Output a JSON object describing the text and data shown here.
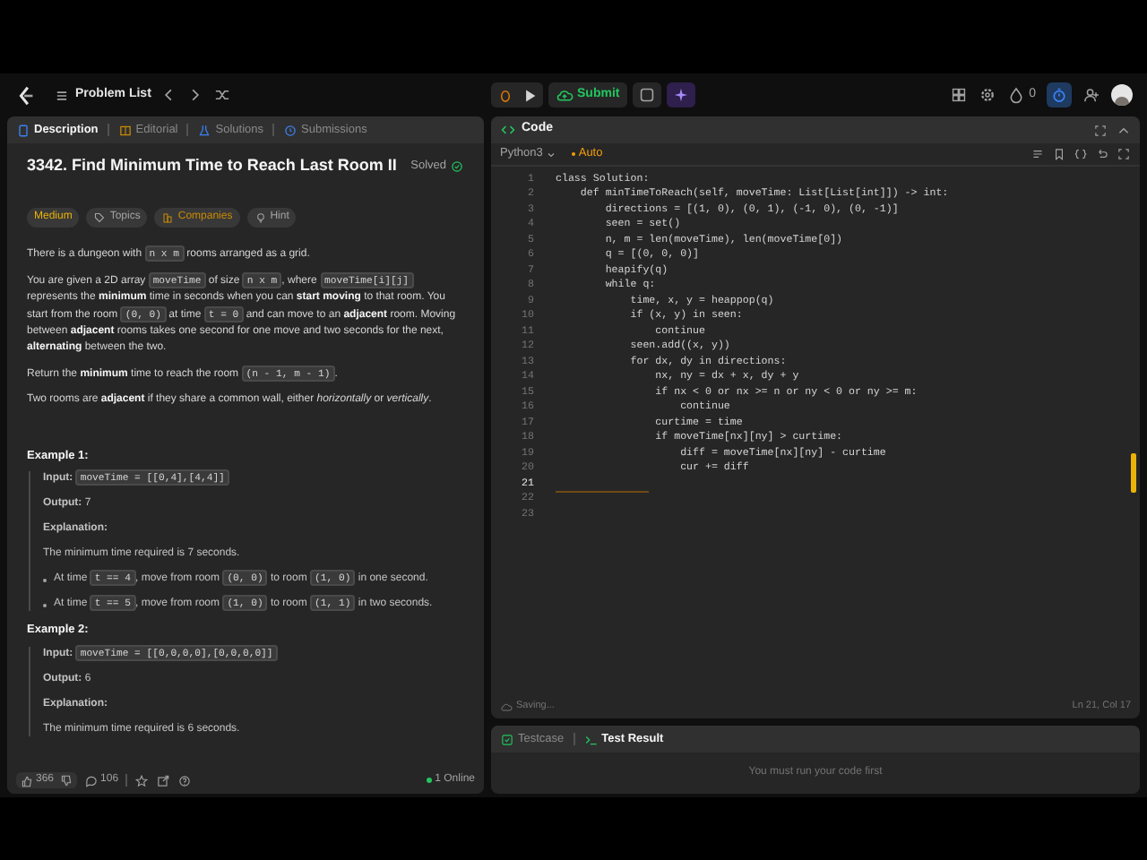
{
  "nav": {
    "problem_list": "Problem List",
    "submit": "Submit",
    "streak": "0"
  },
  "left_tabs": [
    {
      "label": "Description",
      "selected": true
    },
    {
      "label": "Editorial",
      "selected": false
    },
    {
      "label": "Solutions",
      "selected": false
    },
    {
      "label": "Submissions",
      "selected": false
    }
  ],
  "problem": {
    "title": "3342. Find Minimum Time to Reach Last Room II",
    "status": "Solved",
    "tags": [
      {
        "label": "Medium",
        "kind": "difficulty"
      },
      {
        "label": "Topics",
        "kind": "topics"
      },
      {
        "label": "Companies",
        "kind": "companies"
      },
      {
        "label": "Hint",
        "kind": "hint"
      }
    ],
    "paragraphs": [
      [
        {
          "kind": "text",
          "text": "There is a dungeon with "
        },
        {
          "kind": "code",
          "text": "n x m"
        },
        {
          "kind": "text",
          "text": " rooms arranged as a grid."
        }
      ],
      [
        {
          "kind": "text",
          "text": "You are given a 2D array "
        },
        {
          "kind": "code",
          "text": "moveTime"
        },
        {
          "kind": "text",
          "text": " of size "
        },
        {
          "kind": "code",
          "text": "n x m"
        },
        {
          "kind": "text",
          "text": ", where "
        },
        {
          "kind": "code",
          "text": "moveTime[i][j]"
        },
        {
          "kind": "text",
          "text": " represents the **minimum** time in seconds when you can **start moving** to that room. You start from the room "
        },
        {
          "kind": "code",
          "text": "(0, 0)"
        },
        {
          "kind": "text",
          "text": " at time "
        },
        {
          "kind": "code",
          "text": "t = 0"
        },
        {
          "kind": "text",
          "text": " and can move to an **adjacent** room. Moving between **adjacent** rooms takes one second for one move and two seconds for the next, **alternating** between the two."
        }
      ],
      [
        {
          "kind": "text",
          "text": "Return the **minimum** time to reach the room "
        },
        {
          "kind": "code",
          "text": "(n - 1, m - 1)"
        },
        {
          "kind": "text",
          "text": "."
        }
      ],
      [
        {
          "kind": "text",
          "text": "Two rooms are **adjacent** if they share a common wall, either *horizontally* or *vertically*."
        }
      ]
    ],
    "examples": [
      {
        "title": "Example 1:",
        "lines": [
          {
            "kind": "line",
            "segments": [
              {
                "kind": "text",
                "text": "**Input:** "
              },
              {
                "kind": "code",
                "text": "moveTime = [[0,4],[4,4]]"
              }
            ]
          },
          {
            "kind": "line",
            "segments": [
              {
                "kind": "text",
                "text": "**Output:** 7"
              }
            ]
          },
          {
            "kind": "line",
            "segments": [
              {
                "kind": "text",
                "text": "**Explanation:**"
              }
            ]
          },
          {
            "kind": "line",
            "segments": [
              {
                "kind": "text",
                "text": "The minimum time required is 7 seconds."
              }
            ]
          },
          {
            "kind": "bullet",
            "segments": [
              {
                "kind": "text",
                "text": "At time "
              },
              {
                "kind": "code",
                "text": "t == 4"
              },
              {
                "kind": "text",
                "text": ", move from room "
              },
              {
                "kind": "code",
                "text": "(0, 0)"
              },
              {
                "kind": "text",
                "text": " to room "
              },
              {
                "kind": "code",
                "text": "(1, 0)"
              },
              {
                "kind": "text",
                "text": " in one second."
              }
            ]
          },
          {
            "kind": "bullet",
            "segments": [
              {
                "kind": "text",
                "text": "At time "
              },
              {
                "kind": "code",
                "text": "t == 5"
              },
              {
                "kind": "text",
                "text": ", move from room "
              },
              {
                "kind": "code",
                "text": "(1, 0)"
              },
              {
                "kind": "text",
                "text": " to room "
              },
              {
                "kind": "code",
                "text": "(1, 1)"
              },
              {
                "kind": "text",
                "text": " in two seconds."
              }
            ]
          }
        ]
      },
      {
        "title": "Example 2:",
        "lines": [
          {
            "kind": "line",
            "segments": [
              {
                "kind": "text",
                "text": "**Input:** "
              },
              {
                "kind": "code",
                "text": "moveTime = [[0,0,0,0],[0,0,0,0]]"
              }
            ]
          },
          {
            "kind": "line",
            "segments": [
              {
                "kind": "text",
                "text": "**Output:** 6"
              }
            ]
          },
          {
            "kind": "line",
            "segments": [
              {
                "kind": "text",
                "text": "**Explanation:**"
              }
            ]
          },
          {
            "kind": "line",
            "segments": [
              {
                "kind": "text",
                "text": "The minimum time required is 6 seconds."
              }
            ]
          }
        ]
      }
    ]
  },
  "footer": {
    "likes": "366",
    "comments": "106",
    "online": "1 Online"
  },
  "code": {
    "title": "Code",
    "language": "Python3",
    "mode": "Auto",
    "lines": [
      {
        "n": "1",
        "text": "class Solution:",
        "current": false
      },
      {
        "n": "2",
        "text": "    def minTimeToReach(self, moveTime: List[List[int]]) -> int:",
        "current": false
      },
      {
        "n": "3",
        "text": "        directions = [(1, 0), (0, 1), (-1, 0), (0, -1)]",
        "current": false
      },
      {
        "n": "4",
        "text": "        seen = set()",
        "current": false
      },
      {
        "n": "5",
        "text": "        n, m = len(moveTime), len(moveTime[0])",
        "current": false
      },
      {
        "n": "6",
        "text": "        q = [(0, 0, 0)]",
        "current": false
      },
      {
        "n": "7",
        "text": "        heapify(q)",
        "current": false
      },
      {
        "n": "8",
        "text": "        while q:",
        "current": false
      },
      {
        "n": "9",
        "text": "            time, x, y = heappop(q)",
        "current": false
      },
      {
        "n": "10",
        "text": "            if (x, y) in seen:",
        "current": false
      },
      {
        "n": "11",
        "text": "                continue",
        "current": false
      },
      {
        "n": "12",
        "text": "            seen.add((x, y))",
        "current": false
      },
      {
        "n": "13",
        "text": "            for dx, dy in directions:",
        "current": false
      },
      {
        "n": "14",
        "text": "                nx, ny = dx + x, dy + y",
        "current": false
      },
      {
        "n": "15",
        "text": "                if nx < 0 or nx >= n or ny < 0 or ny >= m:",
        "current": false
      },
      {
        "n": "16",
        "text": "                    continue",
        "current": false
      },
      {
        "n": "17",
        "text": "                curtime = time",
        "current": false
      },
      {
        "n": "18",
        "text": "                if moveTime[nx][ny] > curtime:",
        "current": false
      },
      {
        "n": "19",
        "text": "                    diff = moveTime[nx][ny] - curtime",
        "current": false
      },
      {
        "n": "20",
        "text": "                    cur += diff",
        "current": false
      },
      {
        "n": "21",
        "current": true
      },
      {
        "n": "22",
        "current": false
      },
      {
        "n": "23",
        "current": false
      }
    ],
    "status": "Saving...",
    "position": "Ln 21, Col 17"
  },
  "test_tabs": [
    {
      "label": "Testcase",
      "selected": false
    },
    {
      "label": "Test Result",
      "selected": true
    }
  ],
  "test_message": "You must run your code first"
}
